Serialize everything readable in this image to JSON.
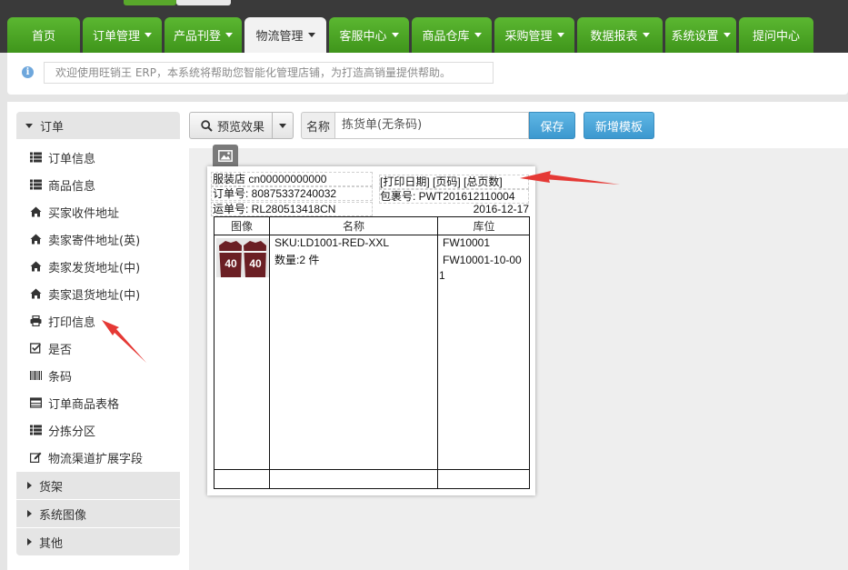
{
  "nav": {
    "tabs": [
      {
        "label": "首页",
        "caret": false,
        "active": false
      },
      {
        "label": "订单管理",
        "caret": true,
        "active": false
      },
      {
        "label": "产品刊登",
        "caret": true,
        "active": false
      },
      {
        "label": "物流管理",
        "caret": true,
        "active": true
      },
      {
        "label": "客服中心",
        "caret": true,
        "active": false
      },
      {
        "label": "商品仓库",
        "caret": true,
        "active": false
      },
      {
        "label": "采购管理",
        "caret": true,
        "active": false
      },
      {
        "label": "数据报表",
        "caret": true,
        "active": false
      },
      {
        "label": "系统设置",
        "caret": true,
        "active": false
      },
      {
        "label": "提问中心",
        "caret": false,
        "active": false
      }
    ]
  },
  "notice": {
    "text": "欢迎使用旺销王 ERP，本系统将帮助您智能化管理店铺，为打造高销量提供帮助。"
  },
  "sidebar": {
    "group_title": "订单",
    "items": [
      {
        "label": "订单信息",
        "icon": "list-icon"
      },
      {
        "label": "商品信息",
        "icon": "list-icon"
      },
      {
        "label": "买家收件地址",
        "icon": "home-icon"
      },
      {
        "label": "卖家寄件地址(英)",
        "icon": "home-icon"
      },
      {
        "label": "卖家发货地址(中)",
        "icon": "home-icon"
      },
      {
        "label": "卖家退货地址(中)",
        "icon": "home-icon"
      },
      {
        "label": "打印信息",
        "icon": "print-icon"
      },
      {
        "label": "是否",
        "icon": "checkbox-icon"
      },
      {
        "label": "条码",
        "icon": "barcode-icon"
      },
      {
        "label": "订单商品表格",
        "icon": "table-icon"
      },
      {
        "label": "分拣分区",
        "icon": "list-icon"
      },
      {
        "label": "物流渠道扩展字段",
        "icon": "edit-icon"
      }
    ],
    "collapsed_groups": [
      "货架",
      "系统图像",
      "其他"
    ]
  },
  "toolbar": {
    "preview_label": "预览效果",
    "name_label": "名称",
    "name_value": "拣货单(无条码)",
    "save_label": "保存",
    "new_template_label": "新增模板"
  },
  "paper": {
    "shop": "服装店 cn00000000000",
    "print_meta": "[打印日期] [页码] [总页数]",
    "order_no": "订单号:  80875337240032",
    "package_no": "包裹号:  PWT201612110004",
    "tracking_no": "运单号:  RL280513418CN",
    "date": "2016-12-17",
    "table": {
      "headers": [
        "图像",
        "名称",
        "库位"
      ],
      "sku": "SKU:LD1001-RED-XXL",
      "qty": "数量:2  件",
      "location_1": "FW10001",
      "location_2": "FW10001-10-00",
      "location_2_wrap": "1",
      "jersey_number": "40"
    }
  },
  "colors": {
    "nav_green": "#4aa421",
    "save_blue": "#4aa6db",
    "arrow_red": "#e53935"
  }
}
